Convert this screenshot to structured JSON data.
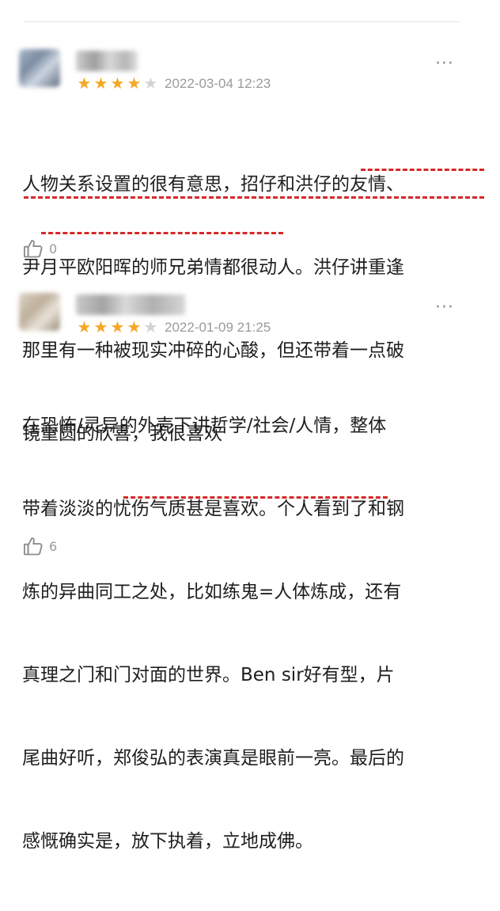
{
  "reviews": [
    {
      "stars_filled": 4,
      "stars_total": 5,
      "date": "2022-03-04 12:23",
      "more_label": "···",
      "lines": [
        "人物关系设置的很有意思，招仔和洪仔的友情、",
        "尹月平欧阳晖的师兄弟情都很动人。洪仔讲重逢",
        "那里有一种被现实冲碎的心酸，但还带着一点破",
        "镜重圆的欣喜，我很喜欢"
      ],
      "likes": "0"
    },
    {
      "stars_filled": 4,
      "stars_total": 5,
      "date": "2022-01-09 21:25",
      "more_label": "···",
      "lines": [
        "在恐怖/灵异的外壳下讲哲学/社会/人情，整体",
        "带着淡淡的忧伤气质甚是喜欢。个人看到了和钢",
        "炼的异曲同工之处，比如练鬼=人体炼成，还有",
        "真理之门和门对面的世界。Ben sir好有型，片",
        "尾曲好听，郑俊弘的表演真是眼前一亮。最后的",
        "感慨确实是，放下执着，立地成佛。"
      ],
      "likes": "6"
    }
  ],
  "colors": {
    "star_on": "#f5a623",
    "star_off": "#d3d3d3",
    "underline": "#d62828",
    "meta_text": "#9a9a9a"
  },
  "icons": {
    "stars": "star-icon",
    "like": "thumbs-up-icon",
    "more": "more-icon"
  }
}
